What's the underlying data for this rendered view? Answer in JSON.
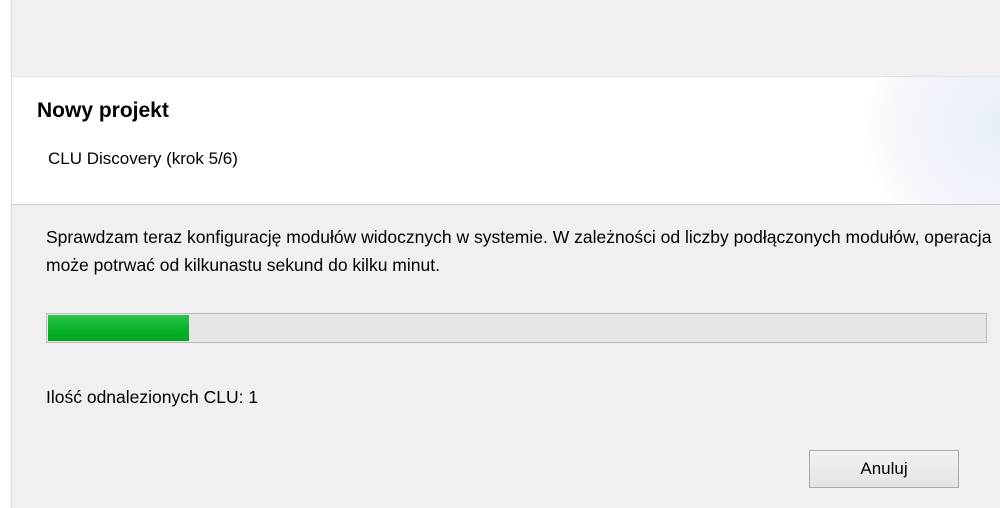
{
  "header": {
    "title": "Nowy projekt",
    "subtitle": "CLU Discovery (krok 5/6)"
  },
  "body": {
    "description": "Sprawdzam teraz konfigurację modułów widocznych w systemie. W zależności od liczby podłączonych modułów, operacja może potrwać od kilkunastu sekund do kilku minut.",
    "progress_fraction": 0.15,
    "progress_color": "#06b025",
    "found_label": "Ilość odnalezionych CLU: 1"
  },
  "buttons": {
    "cancel_label": "Anuluj"
  }
}
